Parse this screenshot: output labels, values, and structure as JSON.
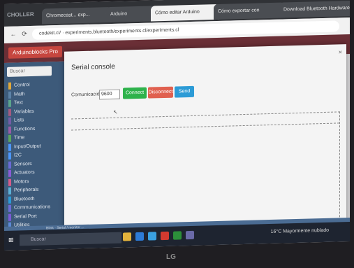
{
  "browser": {
    "tabs": [
      {
        "label": "Chromecast... exp...",
        "active": false
      },
      {
        "label": "Arduino",
        "active": false
      },
      {
        "label": "Cómo editar Arduino",
        "active": true
      },
      {
        "label": "Cómo exportar con",
        "active": false
      },
      {
        "label": "Download Bluetooth Hardware",
        "active": false
      }
    ],
    "url": "codekit.cl/ · experiments.bluetooth/experiments.cl/experiments.cl"
  },
  "app": {
    "logo": "CHOLLER",
    "brand": "Arduinoblocks Pro"
  },
  "sidebar": {
    "search_placeholder": "Buscar",
    "items": [
      {
        "label": "Control",
        "color": "#e1a83a"
      },
      {
        "label": "Math",
        "color": "#5c81a6"
      },
      {
        "label": "Text",
        "color": "#5ba58c"
      },
      {
        "label": "Variables",
        "color": "#a55b80"
      },
      {
        "label": "Lists",
        "color": "#745ca6"
      },
      {
        "label": "Functions",
        "color": "#9a5ca6"
      },
      {
        "label": "Time",
        "color": "#5ca65c"
      },
      {
        "label": "Input/Output",
        "color": "#4c97ff"
      },
      {
        "label": "I2C",
        "color": "#4c97ff"
      },
      {
        "label": "Sensors",
        "color": "#6a6ad6"
      },
      {
        "label": "Actuators",
        "color": "#8a5cd6"
      },
      {
        "label": "Motors",
        "color": "#d65c8a"
      },
      {
        "label": "Peripherals",
        "color": "#5cb0d6"
      },
      {
        "label": "Bluetooth",
        "color": "#2c9bd6"
      },
      {
        "label": "Communications",
        "color": "#6c6cd6"
      },
      {
        "label": "Serial Port",
        "color": "#7a5ad6"
      },
      {
        "label": "Utilities",
        "color": "#5c8ad6"
      }
    ]
  },
  "serial_console": {
    "title": "Serial console",
    "close": "×",
    "baud_label": "Comunicación",
    "baud_value": "9600",
    "connect_label": "Connect",
    "disconnect_label": "Disconnect",
    "send_label": "Send"
  },
  "status_bar": {
    "text": "Blink · Serial / monitor ..."
  },
  "taskbar": {
    "search_text": "Buscar",
    "tray_text": "16°C  Mayormente nublado",
    "icons": [
      "#e2b23c",
      "#2d7bd6",
      "#3aa0e0",
      "#d33a2f",
      "#2c8f3a",
      "#6a6aa8"
    ]
  },
  "monitor": {
    "logo": "LG"
  }
}
